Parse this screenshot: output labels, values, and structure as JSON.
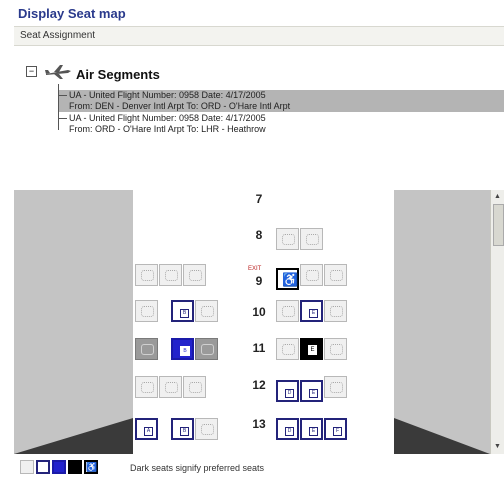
{
  "window": {
    "title": "Display Seat map"
  },
  "menu": {
    "items": [
      "Seat Assignment"
    ]
  },
  "tree": {
    "root_label": "Air Segments",
    "expander": "−",
    "segments": [
      {
        "line1": "UA - United   Flight Number: 0958   Date: 4/17/2005",
        "line2": "From: DEN - Denver Intl Arpt   To: ORD - O'Hare Intl Arpt",
        "selected": true
      },
      {
        "line1": "UA - United   Flight Number: 0958   Date: 4/17/2005",
        "line2": "From: ORD - O'Hare Intl Arpt   To: LHR - Heathrow",
        "selected": false
      }
    ]
  },
  "seatmap": {
    "rows": [
      "7",
      "8",
      "9",
      "10",
      "11",
      "12",
      "13"
    ],
    "exit_label": "EXIT",
    "seat_letters": {
      "r10_B": "B",
      "r10_E": "E",
      "r11_B": "B",
      "r11_E": "E",
      "r12_D": "D",
      "r12_E": "E",
      "r13_A": "A",
      "r13_B": "B",
      "r13_D": "D",
      "r13_E": "E",
      "r13_F": "F",
      "r9_D": "♿"
    }
  },
  "legend": {
    "text": "Dark seats signify preferred seats"
  },
  "colors": {
    "title": "#2a3a8c",
    "preferred_border": "#23237a",
    "selected_seat": "#2222cc",
    "occupied": "#9a9a9a"
  }
}
